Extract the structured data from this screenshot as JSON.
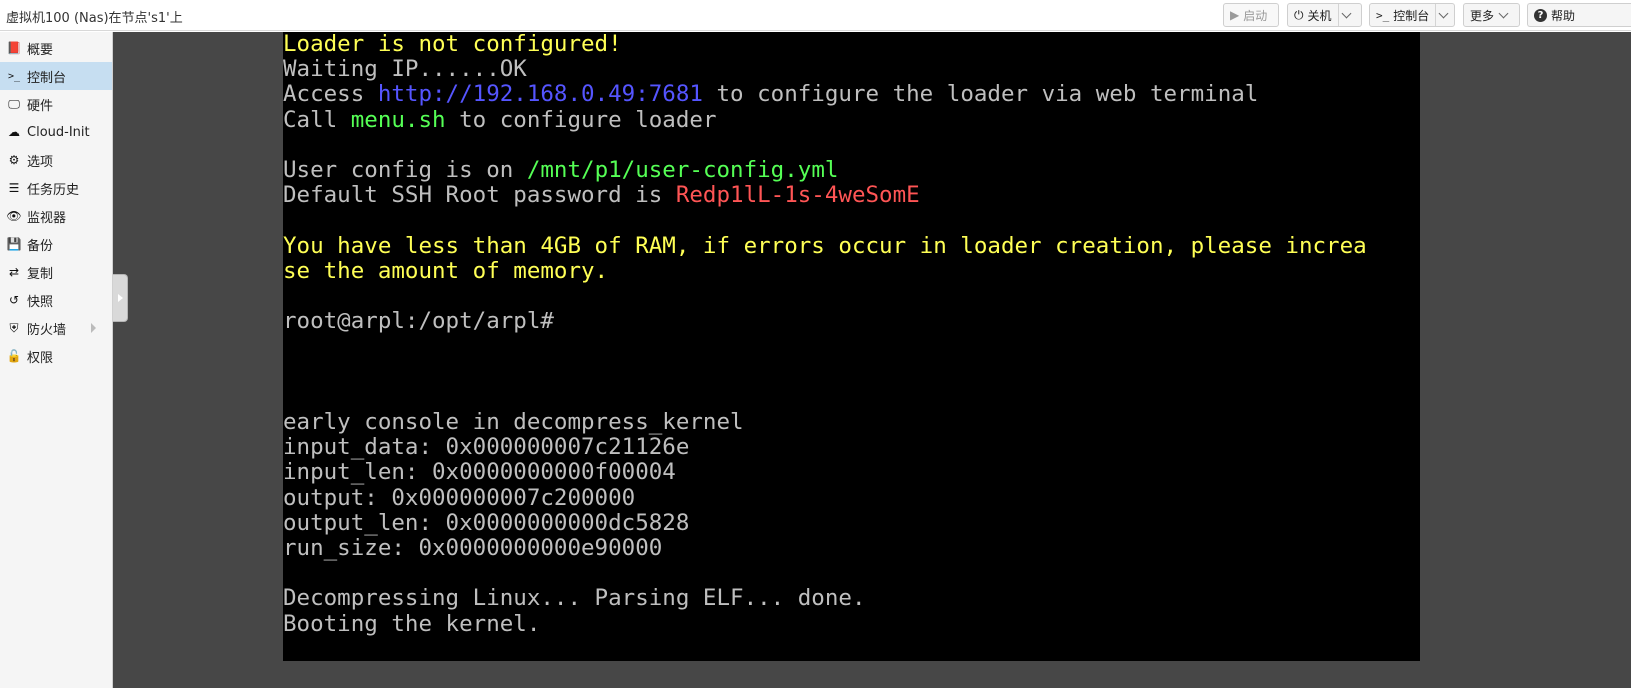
{
  "window": {
    "title": "虚拟机100 (Nas)在节点's1'上"
  },
  "toolbar": {
    "start_label": "启动",
    "shutdown_label": "关机",
    "console_label": "控制台",
    "more_label": "更多",
    "help_label": "帮助"
  },
  "sidebar": {
    "items": [
      {
        "label": "概要",
        "icon": "summary-icon"
      },
      {
        "label": "控制台",
        "icon": "console-icon",
        "active": true
      },
      {
        "label": "硬件",
        "icon": "monitor-icon"
      },
      {
        "label": "Cloud-Init",
        "icon": "cloud-icon"
      },
      {
        "label": "选项",
        "icon": "gear-icon"
      },
      {
        "label": "任务历史",
        "icon": "list-icon"
      },
      {
        "label": "监视器",
        "icon": "eye-icon"
      },
      {
        "label": "备份",
        "icon": "floppy-icon"
      },
      {
        "label": "复制",
        "icon": "retweet-icon"
      },
      {
        "label": "快照",
        "icon": "history-icon"
      },
      {
        "label": "防火墙",
        "icon": "shield-icon",
        "has_submenu": true
      },
      {
        "label": "权限",
        "icon": "unlock-icon"
      }
    ]
  },
  "terminal": {
    "lines": [
      [
        {
          "t": "Loader is not configured!",
          "c": "yellow"
        }
      ],
      [
        {
          "t": "Waiting IP......OK",
          "c": "gray"
        }
      ],
      [
        {
          "t": "Access ",
          "c": "gray"
        },
        {
          "t": "http://192.168.0.49:7681",
          "c": "blue"
        },
        {
          "t": " to configure the loader via web terminal",
          "c": "gray"
        }
      ],
      [
        {
          "t": "Call ",
          "c": "gray"
        },
        {
          "t": "menu.sh",
          "c": "green"
        },
        {
          "t": " to configure loader",
          "c": "gray"
        }
      ],
      [],
      [
        {
          "t": "User config is on ",
          "c": "gray"
        },
        {
          "t": "/mnt/p1/user-config.yml",
          "c": "green"
        }
      ],
      [
        {
          "t": "Default SSH Root password is ",
          "c": "gray"
        },
        {
          "t": "Redp1lL-1s-4weSomE",
          "c": "red"
        }
      ],
      [],
      [
        {
          "t": "You have less than 4GB of RAM, if errors occur in loader creation, please increa",
          "c": "yellow"
        }
      ],
      [
        {
          "t": "se the amount of memory.",
          "c": "yellow"
        }
      ],
      [],
      [
        {
          "t": "root@arpl:/opt/arpl#",
          "c": "gray"
        }
      ],
      [],
      [],
      [],
      [
        {
          "t": "early console in decompress_kernel",
          "c": "gray"
        }
      ],
      [
        {
          "t": "input_data: 0x000000007c21126e",
          "c": "gray"
        }
      ],
      [
        {
          "t": "input_len: 0x0000000000f00004",
          "c": "gray"
        }
      ],
      [
        {
          "t": "output: 0x000000007c200000",
          "c": "gray"
        }
      ],
      [
        {
          "t": "output_len: 0x0000000000dc5828",
          "c": "gray"
        }
      ],
      [
        {
          "t": "run_size: 0x0000000000e90000",
          "c": "gray"
        }
      ],
      [],
      [
        {
          "t": "Decompressing Linux... Parsing ELF... done.",
          "c": "gray"
        }
      ],
      [
        {
          "t": "Booting the kernel.",
          "c": "gray"
        }
      ]
    ]
  }
}
